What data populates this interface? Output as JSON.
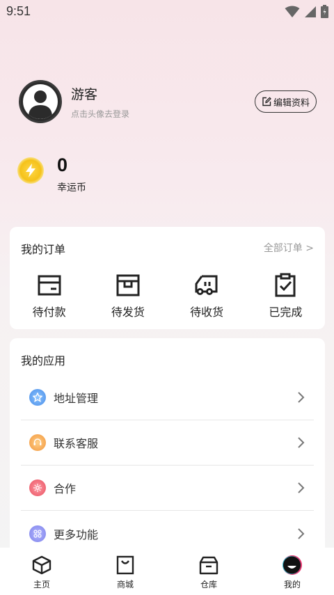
{
  "status_bar": {
    "time": "9:51",
    "icons": [
      "wifi-icon",
      "signal-icon",
      "battery-icon"
    ]
  },
  "profile": {
    "name": "游客",
    "hint": "点击头像去登录",
    "edit_label": "编辑资料"
  },
  "coins": {
    "count": "0",
    "label": "幸运币"
  },
  "orders": {
    "title": "我的订单",
    "all_link": "全部订单 >",
    "items": [
      {
        "label": "待付款",
        "icon": "wallet-icon"
      },
      {
        "label": "待发货",
        "icon": "package-box-icon"
      },
      {
        "label": "待收货",
        "icon": "delivery-truck-icon"
      },
      {
        "label": "已完成",
        "icon": "clipboard-check-icon"
      }
    ]
  },
  "apps": {
    "title": "我的应用",
    "items": [
      {
        "label": "地址管理",
        "icon": "address-icon",
        "color": "#5aa0f0"
      },
      {
        "label": "联系客服",
        "icon": "customer-service-icon",
        "color": "#f2a23b"
      },
      {
        "label": "合作",
        "icon": "cooperation-icon",
        "color": "#f06b7a"
      },
      {
        "label": "更多功能",
        "icon": "more-functions-icon",
        "color": "#8a8ef0"
      }
    ]
  },
  "tabbar": {
    "items": [
      {
        "label": "主页",
        "icon": "home-cube-icon"
      },
      {
        "label": "商城",
        "icon": "shopping-bag-icon"
      },
      {
        "label": "仓库",
        "icon": "warehouse-box-icon"
      },
      {
        "label": "我的",
        "icon": "profile-face-icon"
      }
    ]
  }
}
